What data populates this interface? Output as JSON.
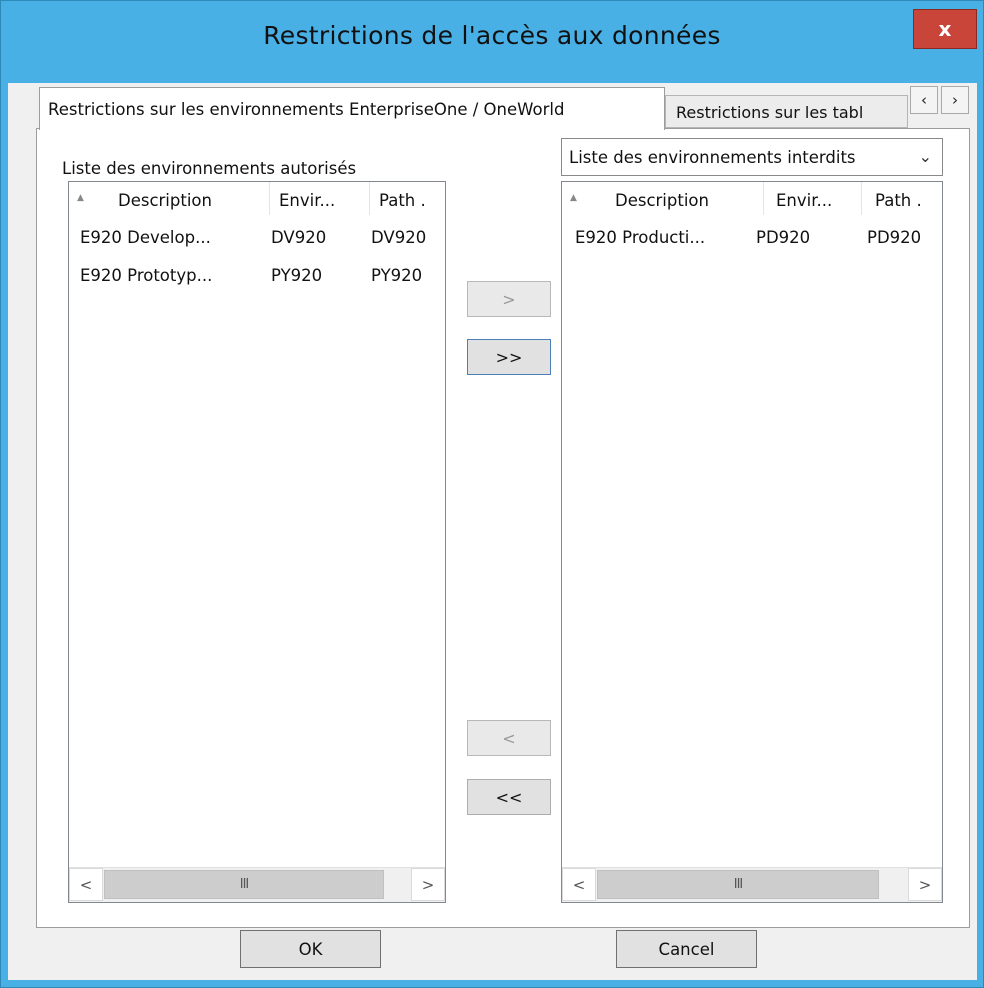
{
  "window": {
    "title": "Restrictions de l'accès aux données",
    "close_label": "x"
  },
  "tabs": {
    "active_label": "Restrictions sur les environnements EnterpriseOne / OneWorld",
    "inactive_label": "Restrictions sur les tabl",
    "scroll_left": "‹",
    "scroll_right": "›"
  },
  "left_list": {
    "label": "Liste des environnements autorisés",
    "columns": [
      "Description",
      "Envir...",
      "Path ."
    ],
    "rows": [
      [
        "E920 Develop...",
        "DV920",
        "DV920"
      ],
      [
        "E920 Prototyp...",
        "PY920",
        "PY920"
      ]
    ]
  },
  "right_list": {
    "selector_value": "Liste des environnements interdits",
    "columns": [
      "Description",
      "Envir...",
      "Path ."
    ],
    "rows": [
      [
        "E920 Producti...",
        "PD920",
        "PD920"
      ]
    ]
  },
  "scrollbar": {
    "left_arrow": "<",
    "right_arrow": ">",
    "grip": "III"
  },
  "move_buttons": {
    "add_one": ">",
    "add_all": ">>",
    "remove_one": "<",
    "remove_all": "<<"
  },
  "dialog_buttons": {
    "ok": "OK",
    "cancel": "Cancel"
  },
  "colors": {
    "title_bar": "#49b0e6",
    "close_button": "#c9453a"
  },
  "icons": {
    "sort": "sort-ascending-icon",
    "dropdown": "chevron-down-icon"
  }
}
